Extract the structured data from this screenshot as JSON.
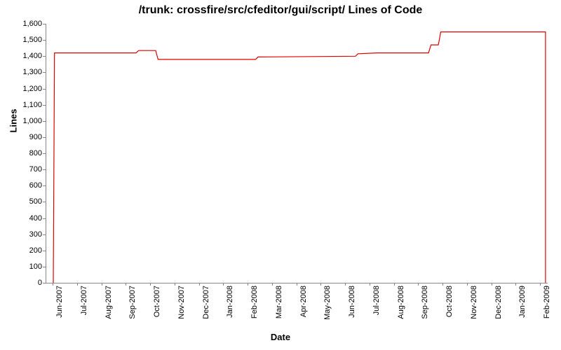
{
  "chart_data": {
    "type": "line",
    "title": "/trunk: crossfire/src/cfeditor/gui/script/ Lines of Code",
    "xlabel": "Date",
    "ylabel": "Lines",
    "ylim": [
      0,
      1600
    ],
    "yticks": [
      0,
      100,
      200,
      300,
      400,
      500,
      600,
      700,
      800,
      900,
      1000,
      1100,
      1200,
      1300,
      1400,
      1500,
      1600
    ],
    "ytick_labels": [
      "0",
      "100",
      "200",
      "300",
      "400",
      "500",
      "600",
      "700",
      "800",
      "900",
      "1,000",
      "1,100",
      "1,200",
      "1,300",
      "1,400",
      "1,500",
      "1,600"
    ],
    "x_categories": [
      "Jun-2007",
      "Jul-2007",
      "Aug-2007",
      "Sep-2007",
      "Oct-2007",
      "Nov-2007",
      "Dec-2007",
      "Jan-2008",
      "Feb-2008",
      "Mar-2008",
      "Apr-2008",
      "May-2008",
      "Jun-2008",
      "Jul-2008",
      "Aug-2008",
      "Sep-2008",
      "Oct-2008",
      "Nov-2008",
      "Dec-2008",
      "Jan-2009",
      "Feb-2009"
    ],
    "series": [
      {
        "name": "Lines of Code",
        "color": "#e00000",
        "points": [
          {
            "xi": 0.0,
            "y": 0
          },
          {
            "xi": 0.05,
            "y": 1420
          },
          {
            "xi": 3.4,
            "y": 1420
          },
          {
            "xi": 3.5,
            "y": 1435
          },
          {
            "xi": 4.2,
            "y": 1435
          },
          {
            "xi": 4.3,
            "y": 1380
          },
          {
            "xi": 8.3,
            "y": 1380
          },
          {
            "xi": 8.4,
            "y": 1395
          },
          {
            "xi": 12.4,
            "y": 1400
          },
          {
            "xi": 12.5,
            "y": 1415
          },
          {
            "xi": 13.3,
            "y": 1420
          },
          {
            "xi": 15.4,
            "y": 1420
          },
          {
            "xi": 15.5,
            "y": 1470
          },
          {
            "xi": 15.8,
            "y": 1470
          },
          {
            "xi": 15.9,
            "y": 1550
          },
          {
            "xi": 20.2,
            "y": 1550
          },
          {
            "xi": 20.2,
            "y": 0
          }
        ]
      }
    ]
  }
}
